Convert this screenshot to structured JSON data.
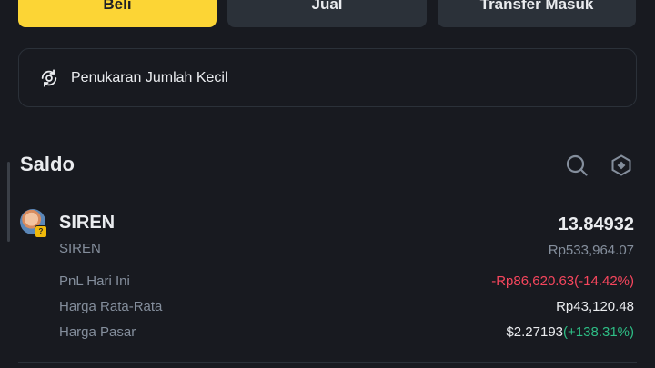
{
  "actions": {
    "buy_label": "Beli",
    "sell_label": "Jual",
    "transfer_label": "Transfer Masuk"
  },
  "small_exchange": {
    "label": "Penukaran Jumlah Kecil",
    "icon": "swap-circle-icon"
  },
  "balance": {
    "title": "Saldo",
    "icons": [
      "search-icon",
      "hexagon-settings-icon"
    ]
  },
  "asset": {
    "name": "SIREN",
    "subtitle": "SIREN",
    "amount": "13.84932",
    "value": "Rp533,964.07",
    "pnl_label": "PnL Hari Ini",
    "pnl_value": "-Rp86,620.63(-14.42%)",
    "avg_price_label": "Harga Rata-Rata",
    "avg_price_value": "Rp43,120.48",
    "market_price_label": "Harga Pasar",
    "market_price_value": "$2.27193",
    "market_price_change": "(+138.31%)"
  },
  "colors": {
    "background": "#181a20",
    "accent": "#fcd535",
    "negative": "#f6465d",
    "positive": "#2ebd85"
  }
}
